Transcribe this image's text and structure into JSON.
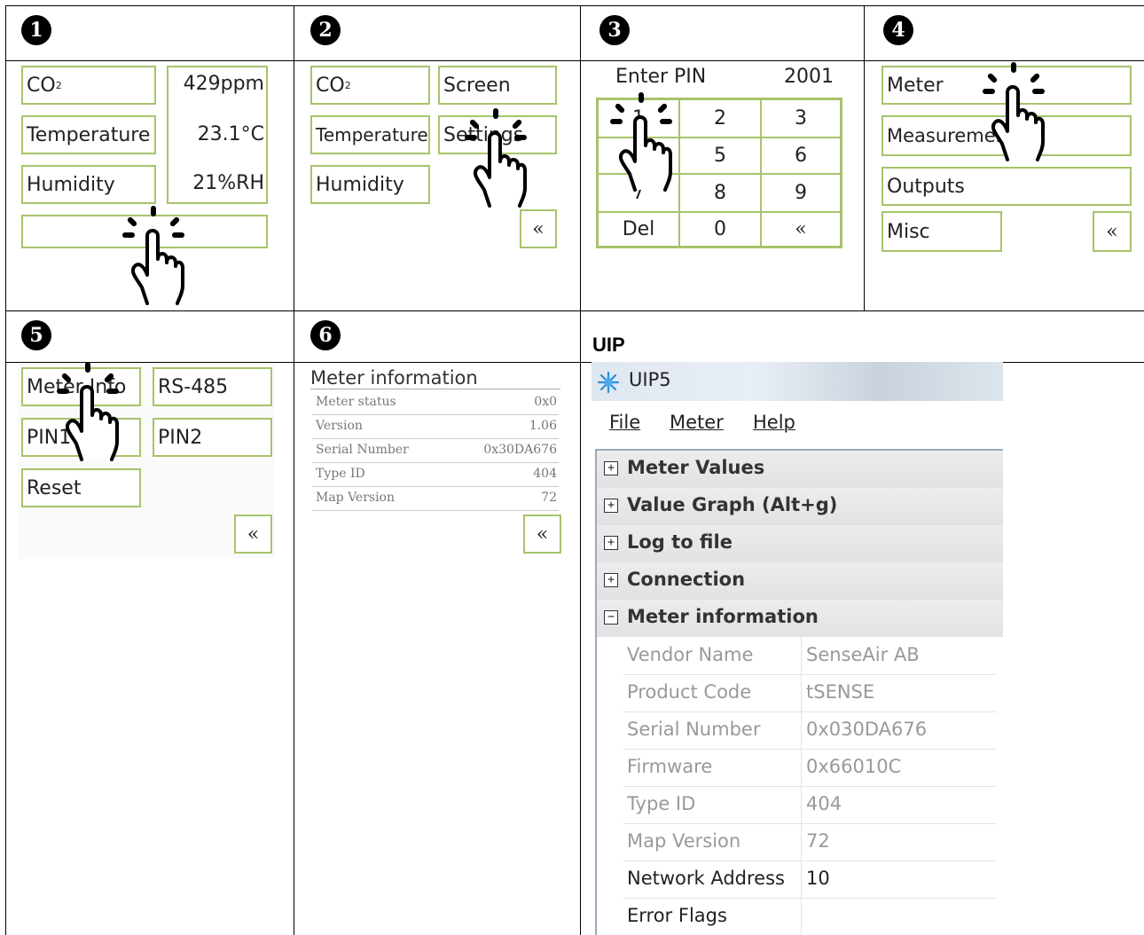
{
  "steps": [
    "1",
    "2",
    "3",
    "4",
    "5",
    "6"
  ],
  "uip_label": "UIP",
  "panel1": {
    "co2_label": "CO",
    "co2_sub": "2",
    "co2_value": "429ppm",
    "temp_label": "Temperature",
    "temp_value": "23.1°C",
    "hum_label": "Humidity",
    "hum_value": "21%RH"
  },
  "panel2": {
    "co2_label": "CO",
    "co2_sub": "2",
    "temp_label": "Temperature",
    "hum_label": "Humidity",
    "screen_label": "Screen",
    "settings_label": "Settings",
    "back_label": "«"
  },
  "panel3": {
    "enter_pin_label": "Enter PIN",
    "pin_value": "2001",
    "keys": [
      "1",
      "2",
      "3",
      "4",
      "5",
      "6",
      "7",
      "8",
      "9",
      "Del",
      "0",
      "«"
    ]
  },
  "panel4": {
    "meter_label": "Meter",
    "measurement_label": "Measurement",
    "outputs_label": "Outputs",
    "misc_label": "Misc",
    "back_label": "«"
  },
  "panel5": {
    "meter_info_label": "Meter Info",
    "rs485_label": "RS-485",
    "pin1_label": "PIN1",
    "pin2_label": "PIN2",
    "reset_label": "Reset",
    "back_label": "«"
  },
  "panel6": {
    "title": "Meter information",
    "rows": [
      {
        "key": "Meter status",
        "value": "0x0"
      },
      {
        "key": "Version",
        "value": "1.06"
      },
      {
        "key": "Serial Number",
        "value": "0x30DA676"
      },
      {
        "key": "Type ID",
        "value": "404"
      },
      {
        "key": "Map Version",
        "value": "72"
      }
    ],
    "back_label": "«"
  },
  "uip_window": {
    "title": "UIP5",
    "menu": [
      "File",
      "Meter",
      "Help"
    ],
    "sections": [
      {
        "label": "Meter Values",
        "state": "+"
      },
      {
        "label": "Value Graph (Alt+g)",
        "state": "+"
      },
      {
        "label": "Log to file",
        "state": "+"
      },
      {
        "label": "Connection",
        "state": "+"
      },
      {
        "label": "Meter information",
        "state": "−"
      }
    ],
    "properties": [
      {
        "key": "Vendor Name",
        "value": "SenseAir AB"
      },
      {
        "key": "Product Code",
        "value": "tSENSE"
      },
      {
        "key": "Serial Number",
        "value": "0x030DA676"
      },
      {
        "key": "Firmware",
        "value": "0x66010C"
      },
      {
        "key": "Type ID",
        "value": "404"
      },
      {
        "key": "Map Version",
        "value": "72"
      },
      {
        "key": "Network Address",
        "value": "10"
      },
      {
        "key": "Error Flags",
        "value": ""
      }
    ]
  },
  "colors": {
    "accent_border": "#a6c46a",
    "badge": "#000000"
  }
}
